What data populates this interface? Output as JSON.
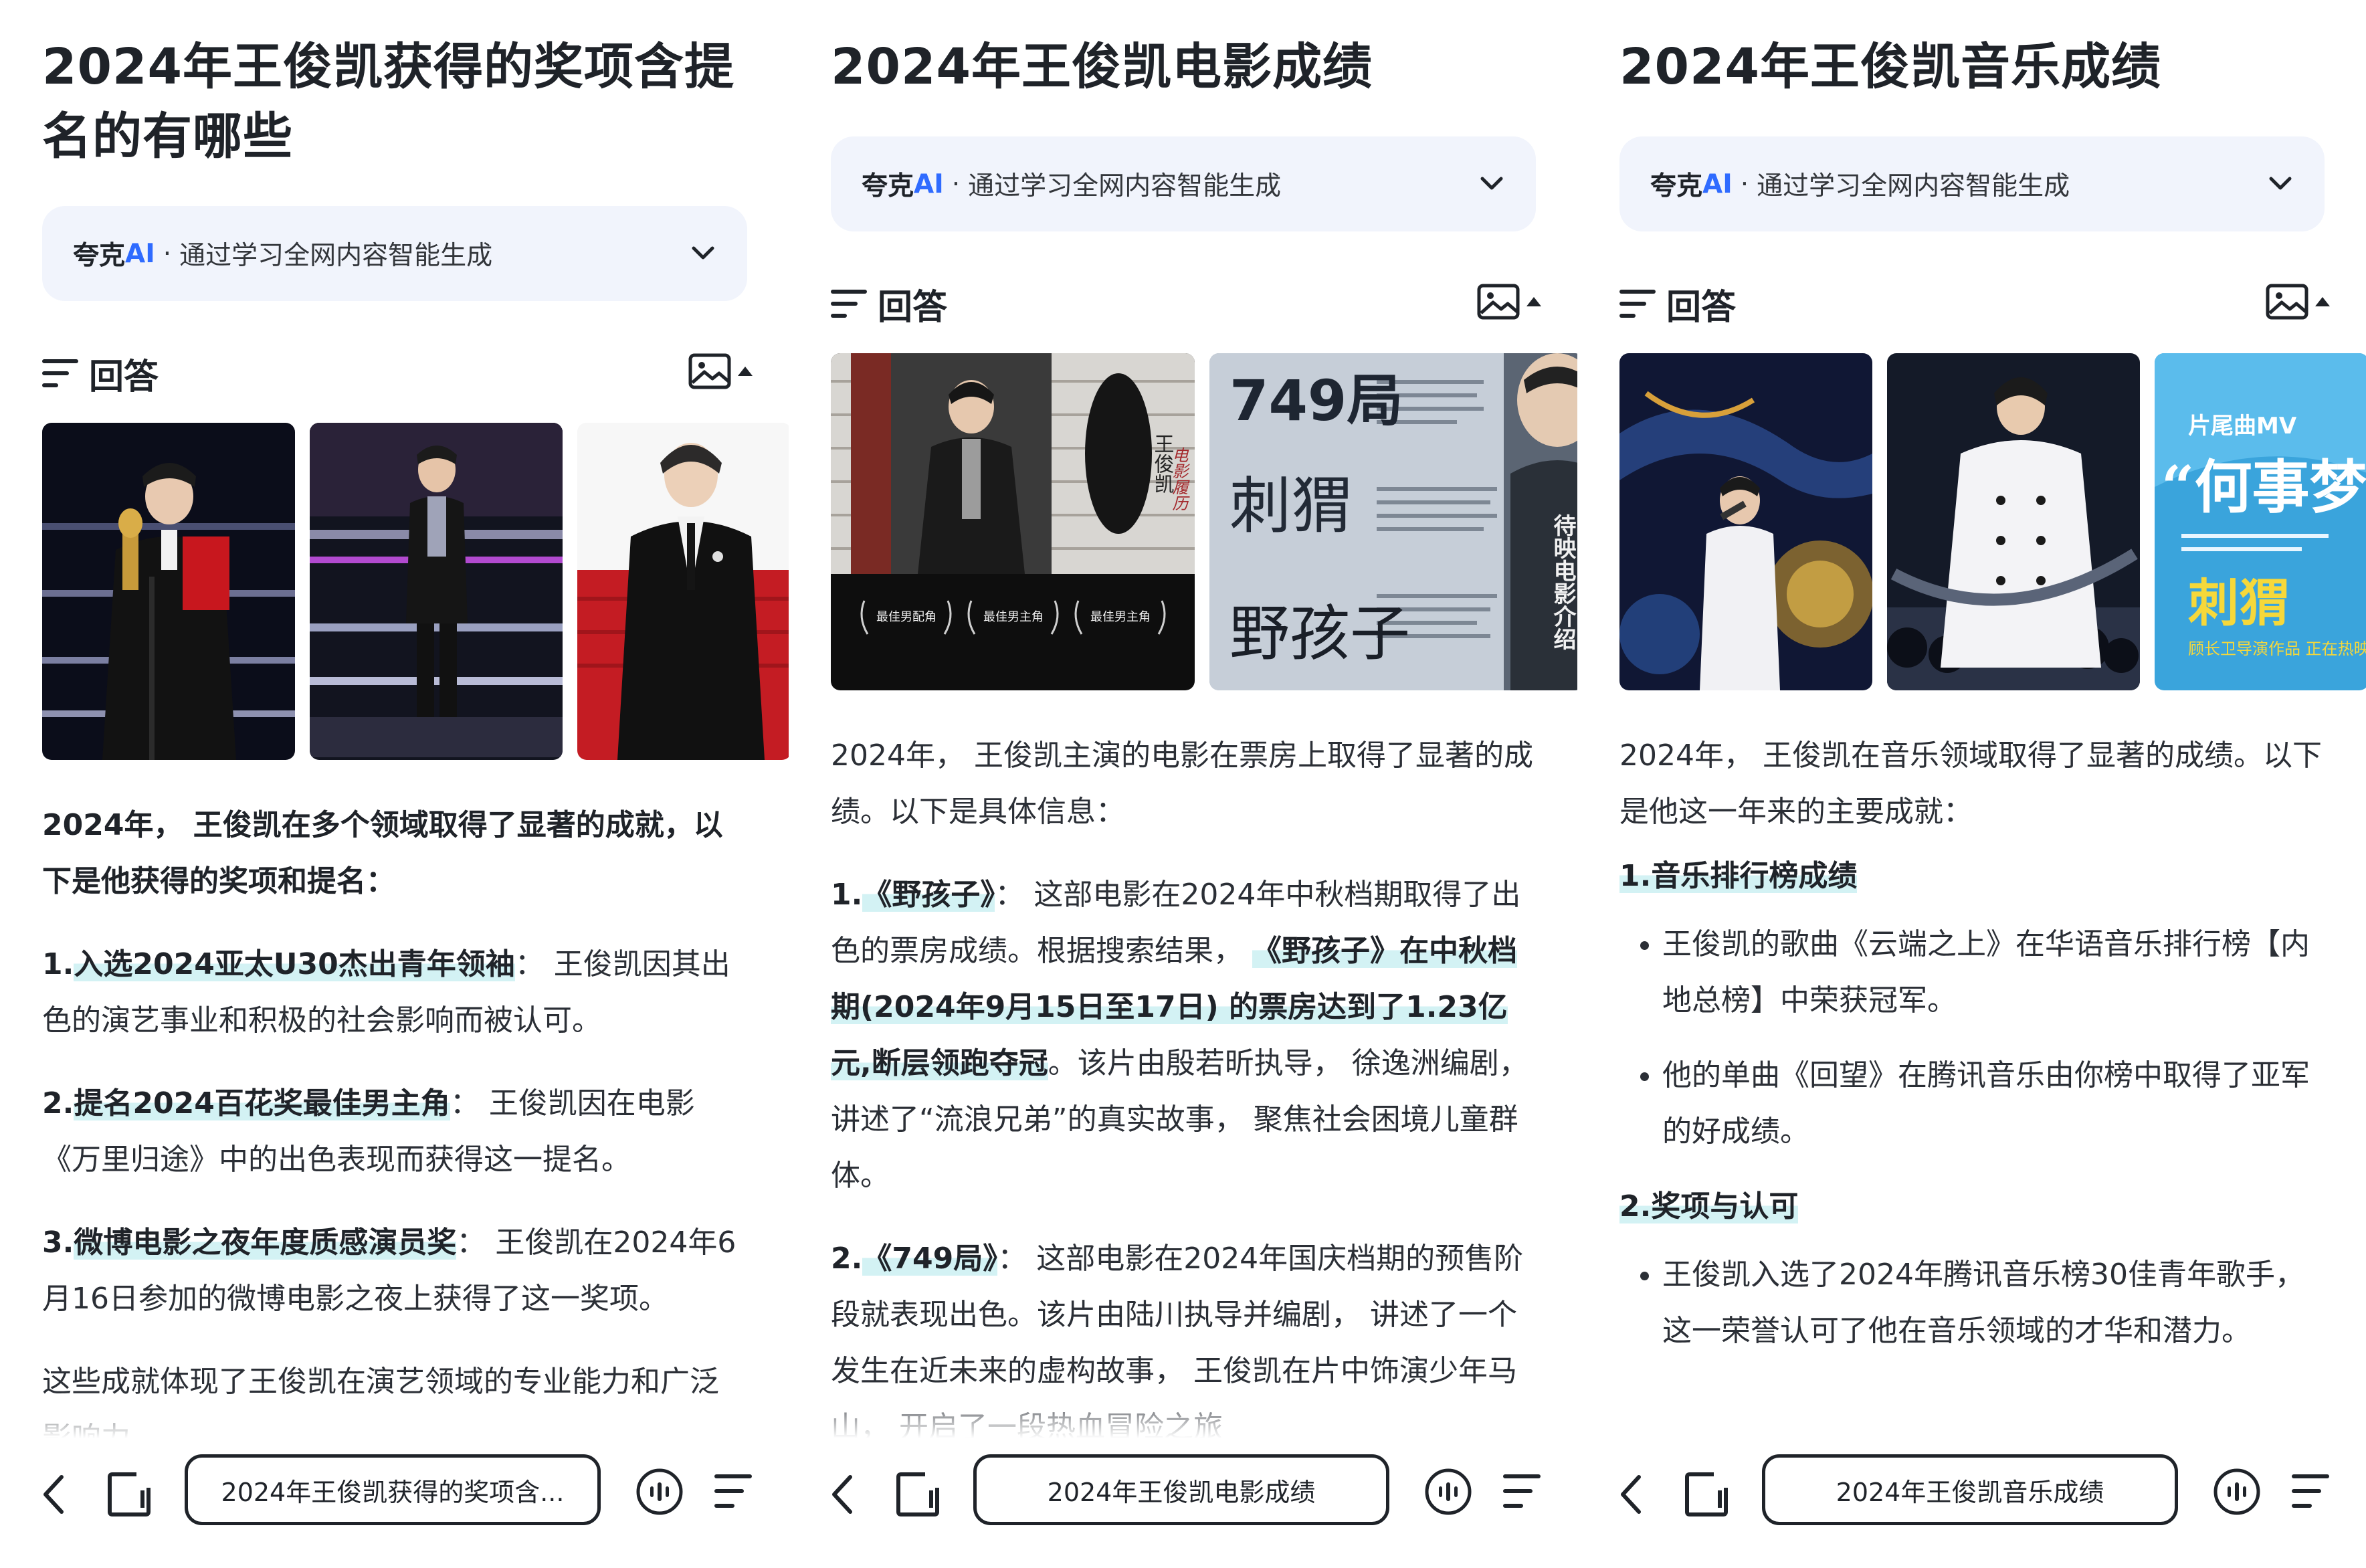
{
  "colors": {
    "accent": "#2f6bff",
    "highlight": "#d3f2f4",
    "ai_bar_bg": "#f1f4fc",
    "text": "#1f2329"
  },
  "ai_bar": {
    "brand": "夸克",
    "brand_accent": "AI",
    "dot": "·",
    "desc": "通过学习全网内容智能生成",
    "icon": "chevron-down-icon"
  },
  "answer_label": "回答",
  "panels": [
    {
      "title": "2024年王俊凯获得的奖项含提名的有哪些",
      "images": [
        "award-stage-photo",
        "performance-stage-photo",
        "red-carpet-photo"
      ],
      "intro": "2024年， 王俊凯在多个领域取得了显著的成就，以下是他获得的奖项和提名：",
      "items": [
        {
          "num": "1.",
          "name": "入选2024亚太U30杰出青年领袖",
          "sep": "：",
          "text": "王俊凯因其出色的演艺事业和积极的社会影响而被认可。"
        },
        {
          "num": "2.",
          "name": "提名2024百花奖最佳男主角",
          "sep": "：",
          "text": "王俊凯因在电影《万里归途》中的出色表现而获得这一提名。"
        },
        {
          "num": "3.",
          "name": "微博电影之夜年度质感演员奖",
          "sep": "：",
          "text": "王俊凯在2024年6月16日参加的微博电影之夜上获得了这一奖项。"
        }
      ],
      "outro": "这些成就体现了王俊凯在演艺领域的专业能力和广泛影响力。",
      "query_pill": "2024年王俊凯获得的奖项含..."
    },
    {
      "title": "2024年王俊凯电影成绩",
      "poster1": {
        "side_text": "王俊凯",
        "script_text": "电影履历",
        "laurels": [
          "最佳男配角",
          "最佳男主角",
          "最佳男主角"
        ]
      },
      "poster2": {
        "big_title": "749局",
        "calligraphy1": "刺猬",
        "calligraphy2": "野孩子",
        "side_text": "待映电影介绍"
      },
      "intro": "2024年， 王俊凯主演的电影在票房上取得了显著的成绩。以下是具体信息：",
      "item1": {
        "num": "1.",
        "name": "《野孩子》",
        "sep": "：",
        "text_a": "这部电影在2024年中秋档期取得了出色的票房成绩。根据搜索结果，",
        "highlight": "《野孩子》在中秋档期(2024年9月15日至17日) 的票房达到了1.23亿元,断层领跑夺冠",
        "text_b": "。该片由殷若昕执导， 徐逸洲编剧，讲述了“流浪兄弟”的真实故事， 聚焦社会困境儿童群体。"
      },
      "item2": {
        "num": "2.",
        "name": "《749局》",
        "sep": "：",
        "text": "这部电影在2024年国庆档期的预售阶段就表现出色。该片由陆川执导并编剧， 讲述了一个发生在近未来的虚构故事， 王俊凯在片中饰演少年马山， 开启了一段热血冒险之旅"
      },
      "query_pill": "2024年王俊凯电影成绩"
    },
    {
      "title": "2024年王俊凯音乐成绩",
      "poster3": {
        "top_text": "片尾曲MV",
        "big_text": "“何事梦里",
        "accent_text": "刺猬",
        "small_text": "顾长卫导演作品 正在热映"
      },
      "intro": "2024年， 王俊凯在音乐领域取得了显著的成绩。以下是他这一年来的主要成就：",
      "sections": [
        {
          "heading": "1.音乐排行榜成绩",
          "bullets": [
            "王俊凯的歌曲《云端之上》在华语音乐排行榜【内地总榜】中荣获冠军。",
            "他的单曲《回望》在腾讯音乐由你榜中取得了亚军的好成绩。"
          ]
        },
        {
          "heading": "2.奖项与认可",
          "bullets": [
            "王俊凯入选了2024年腾讯音乐榜30佳青年歌手， 这一荣誉认可了他在音乐领域的才华和潜力。"
          ]
        }
      ],
      "query_pill": "2024年王俊凯音乐成绩"
    }
  ],
  "bottom_bar_icons": [
    "back-arrow-icon",
    "tab-switch-icon",
    "voice-icon",
    "menu-list-icon"
  ]
}
